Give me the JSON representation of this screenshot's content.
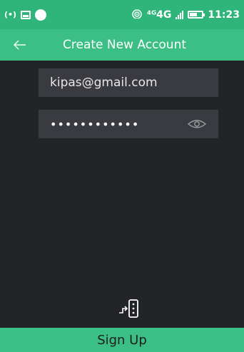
{
  "status_bar": {
    "hotspot": "(•)",
    "network": "⁴ᴳ4G",
    "time": "11:23",
    "icons": [
      "hotspot-icon",
      "image-icon",
      "circle-icon",
      "wifi-icon",
      "signal-icon",
      "battery-icon"
    ]
  },
  "app_bar": {
    "back_icon": "arrow-left-icon",
    "title": "Create New Account"
  },
  "form": {
    "email_value": "kipas@gmail.com",
    "password_masked": "••••••••••••",
    "password_toggle_icon": "eye-icon"
  },
  "footer": {
    "login_icon": "login-icon",
    "signup_label": "Sign Up"
  },
  "colors": {
    "status_bar": "#2fb57a",
    "accent": "#3bbf86",
    "background": "#232428",
    "field_bg": "#3a3b40"
  }
}
